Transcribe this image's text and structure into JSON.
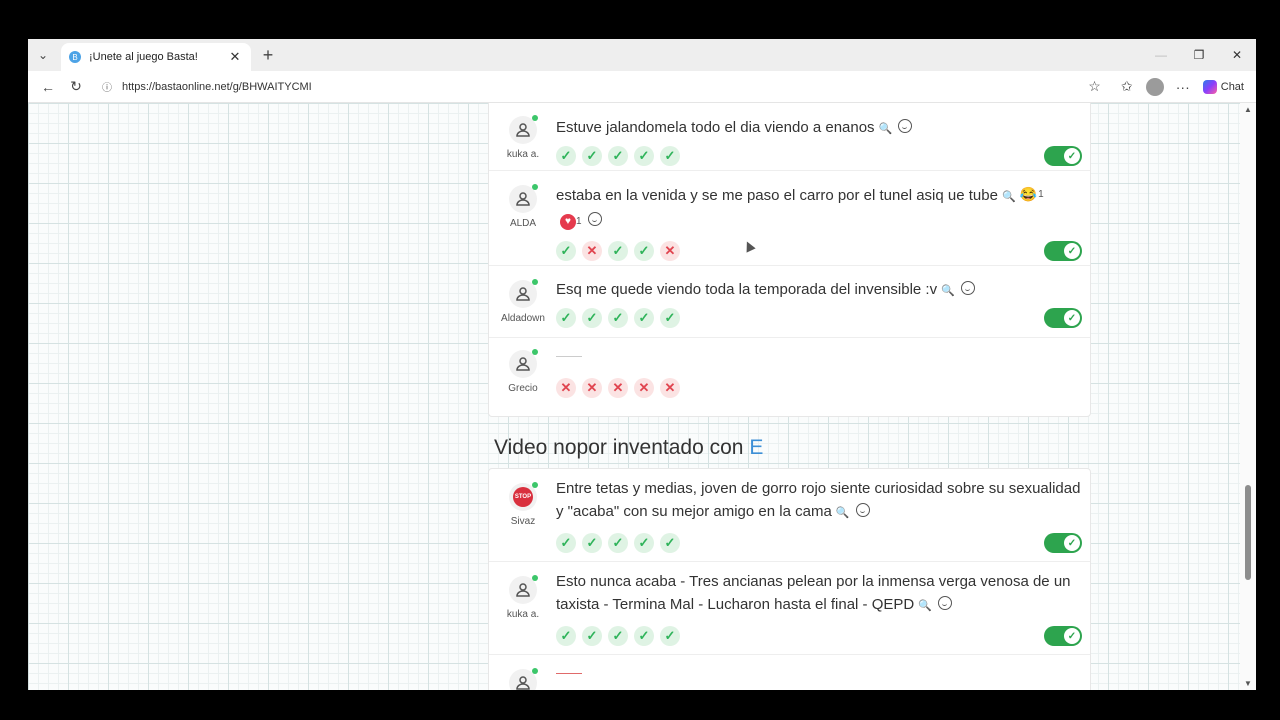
{
  "browser": {
    "tab_title": "¡Unete al juego Basta!",
    "url": "https://bastaonline.net/g/BHWAITYCMI",
    "chat_label": "Chat"
  },
  "section1": {
    "rows": [
      {
        "player": "kuka a.",
        "answer": "Estuve jalandomela todo el dia viendo a enanos",
        "votes": [
          "ok",
          "ok",
          "ok",
          "ok",
          "ok"
        ],
        "valid": true
      },
      {
        "player": "ALDA",
        "answer": "estaba en la venida y se me paso el carro por el tunel asiq ue tube",
        "reaction_laugh_emoji": "😂",
        "reaction_laugh_count": "1",
        "reaction_heart_count": "1",
        "votes": [
          "ok",
          "no",
          "ok",
          "ok",
          "no"
        ],
        "valid": true
      },
      {
        "player": "Aldadown",
        "answer": "Esq me quede viendo toda la temporada del invensible :v",
        "votes": [
          "ok",
          "ok",
          "ok",
          "ok",
          "ok"
        ],
        "valid": true
      },
      {
        "player": "Grecio",
        "answer": "",
        "votes": [
          "no",
          "no",
          "no",
          "no",
          "no"
        ],
        "valid": false
      }
    ]
  },
  "section2": {
    "title": "Video nopor inventado con",
    "letter": "E",
    "rows": [
      {
        "player": "Sivaz",
        "avatar_icon": "stop-sign-icon",
        "avatar_text": "STOP",
        "answer": "Entre tetas y medias, joven de gorro rojo siente curiosidad sobre su sexualidad y \"acaba\" con su mejor amigo en la cama",
        "votes": [
          "ok",
          "ok",
          "ok",
          "ok",
          "ok"
        ],
        "valid": true
      },
      {
        "player": "kuka a.",
        "answer": "Esto nunca acaba - Tres ancianas pelean por la inmensa verga venosa de un taxista - Termina Mal - Lucharon hasta el final - QEPD",
        "votes": [
          "ok",
          "ok",
          "ok",
          "ok",
          "ok"
        ],
        "valid": true
      }
    ]
  },
  "glyphs": {
    "check": "✓",
    "cross": "✕",
    "search": "🔍"
  },
  "colors": {
    "accent": "#3d8fd6",
    "ok": "#2fb35a",
    "no": "#e0444f",
    "toggle_on": "#2da44e"
  }
}
